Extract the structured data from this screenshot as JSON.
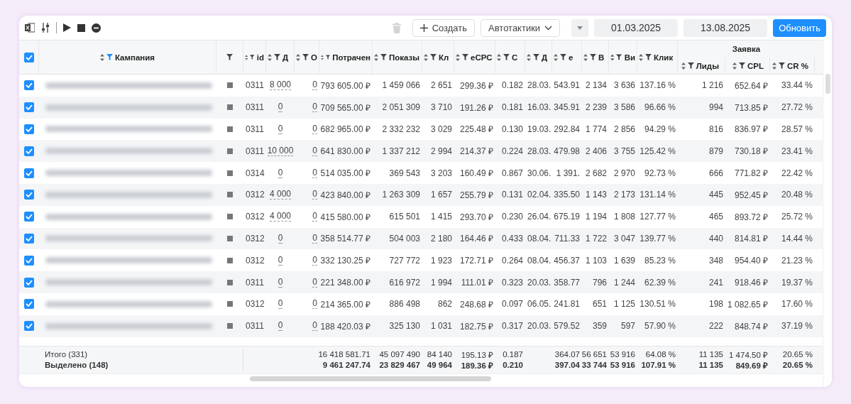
{
  "toolbar": {
    "delete_button": {
      "disabled": true
    },
    "create_button": {
      "label": "Создать"
    },
    "autotactics_button": {
      "label": "Автотактики"
    },
    "date_from": "01.03.2025",
    "date_to": "13.08.2025",
    "refresh_button": {
      "label": "Обновить"
    }
  },
  "table": {
    "header_checked": true,
    "name_column": {
      "label": "Кампания",
      "filter_active": true
    },
    "status_column": {
      "filter_active": false
    },
    "columns": [
      {
        "label": "id",
        "kind": "id",
        "filter_active": false
      },
      {
        "label": "Д",
        "kind": "editable",
        "filter_active": false
      },
      {
        "label": "О",
        "kind": "editable",
        "filter_active": false
      },
      {
        "label": "Потрачен",
        "kind": "number",
        "filter_active": false
      },
      {
        "label": "Показы",
        "kind": "number",
        "filter_active": false
      },
      {
        "label": "Кл",
        "kind": "number",
        "filter_active": false
      },
      {
        "label": "eCPC",
        "kind": "number",
        "filter_active": false
      },
      {
        "label": "С",
        "kind": "number",
        "filter_active": false
      },
      {
        "label": "Д",
        "kind": "date",
        "filter_active": false
      },
      {
        "label": "e",
        "kind": "number",
        "filter_active": false
      },
      {
        "label": "В",
        "kind": "number",
        "filter_active": false
      },
      {
        "label": "Ви",
        "kind": "number",
        "filter_active": false
      },
      {
        "label": "Клик",
        "kind": "number",
        "filter_active": false
      }
    ],
    "groups": [
      {
        "label": "Заявка",
        "columns": [
          {
            "label": "Лиды",
            "kind": "number",
            "filter_active": false
          },
          {
            "label": "CPL",
            "kind": "number",
            "filter_active": false
          },
          {
            "label": "CR %",
            "kind": "number",
            "filter_active": false
          }
        ]
      }
    ],
    "rows": [
      {
        "checked": true,
        "stopped": true,
        "cells": [
          "0311",
          "8 000",
          "0",
          "793 605.00 ₽",
          "1 459 066",
          "2 651",
          "299.36 ₽",
          "0.182",
          "28.03.",
          "543.91",
          "2 134",
          "3 636",
          "137.16 %",
          "1 216",
          "652.64 ₽",
          "33.44 %"
        ]
      },
      {
        "checked": true,
        "stopped": true,
        "cells": [
          "0311",
          "0",
          "0",
          "709 565.00 ₽",
          "2 051 309",
          "3 710",
          "191.26 ₽",
          "0.181",
          "16.03.",
          "345.91",
          "2 239",
          "3 586",
          "96.66 %",
          "994",
          "713.85 ₽",
          "27.72 %"
        ]
      },
      {
        "checked": true,
        "stopped": true,
        "cells": [
          "0311",
          "0",
          "0",
          "682 965.00 ₽",
          "2 332 232",
          "3 029",
          "225.48 ₽",
          "0.130",
          "19.03.",
          "292.84",
          "1 774",
          "2 856",
          "94.29 %",
          "816",
          "836.97 ₽",
          "28.57 %"
        ]
      },
      {
        "checked": true,
        "stopped": true,
        "cells": [
          "0311",
          "10 000",
          "0",
          "641 830.00 ₽",
          "1 337 212",
          "2 994",
          "214.37 ₽",
          "0.224",
          "28.03.",
          "479.98",
          "2 406",
          "3 755",
          "125.42 %",
          "879",
          "730.18 ₽",
          "23.41 %"
        ]
      },
      {
        "checked": true,
        "stopped": true,
        "cells": [
          "0314",
          "0",
          "0",
          "514 035.00 ₽",
          "369 543",
          "3 203",
          "160.49 ₽",
          "0.867",
          "30.06.",
          "1 391.",
          "2 682",
          "2 970",
          "92.73 %",
          "666",
          "771.82 ₽",
          "22.42 %"
        ]
      },
      {
        "checked": true,
        "stopped": true,
        "cells": [
          "0312",
          "4 000",
          "0",
          "423 840.00 ₽",
          "1 263 309",
          "1 657",
          "255.79 ₽",
          "0.131",
          "02.04.",
          "335.50",
          "1 143",
          "2 173",
          "131.14 %",
          "445",
          "952.45 ₽",
          "20.48 %"
        ]
      },
      {
        "checked": true,
        "stopped": true,
        "cells": [
          "0312",
          "4 000",
          "0",
          "415 580.00 ₽",
          "615 501",
          "1 415",
          "293.70 ₽",
          "0.230",
          "26.04.",
          "675.19",
          "1 194",
          "1 808",
          "127.77 %",
          "465",
          "893.72 ₽",
          "25.72 %"
        ]
      },
      {
        "checked": true,
        "stopped": true,
        "cells": [
          "0312",
          "0",
          "0",
          "358 514.77 ₽",
          "504 003",
          "2 180",
          "164.46 ₽",
          "0.433",
          "08.04.",
          "711.33",
          "1 722",
          "3 047",
          "139.77 %",
          "440",
          "814.81 ₽",
          "14.44 %"
        ]
      },
      {
        "checked": true,
        "stopped": true,
        "cells": [
          "0312",
          "0",
          "0",
          "332 130.25 ₽",
          "727 772",
          "1 923",
          "172.71 ₽",
          "0.264",
          "08.04.",
          "456.37",
          "1 103",
          "1 639",
          "85.23 %",
          "348",
          "954.40 ₽",
          "21.23 %"
        ]
      },
      {
        "checked": true,
        "stopped": true,
        "cells": [
          "0311",
          "0",
          "0",
          "221 348.00 ₽",
          "616 972",
          "1 994",
          "111.01 ₽",
          "0.323",
          "20.03.",
          "358.77",
          "796",
          "1 244",
          "62.39 %",
          "241",
          "918.46 ₽",
          "19.37 %"
        ]
      },
      {
        "checked": true,
        "stopped": true,
        "cells": [
          "0312",
          "0",
          "0",
          "214 365.00 ₽",
          "886 498",
          "862",
          "248.68 ₽",
          "0.097",
          "06.05.",
          "241.81",
          "651",
          "1 125",
          "130.51 %",
          "198",
          "1 082.65 ₽",
          "17.60 %"
        ]
      },
      {
        "checked": true,
        "stopped": true,
        "cells": [
          "0311",
          "0",
          "0",
          "188 420.03 ₽",
          "325 130",
          "1 031",
          "182.75 ₽",
          "0.317",
          "20.03.",
          "579.52",
          "359",
          "597",
          "57.90 %",
          "222",
          "848.74 ₽",
          "37.19 %"
        ]
      }
    ],
    "footer": [
      {
        "label": "Итого (331)",
        "kind": "total",
        "values": [
          "16 418 581.71",
          "45 097 490",
          "84 140",
          "195.13 ₽",
          "0.187",
          "364.07",
          "56 651",
          "53 916",
          "64.08 %",
          "11 135",
          "1 474.50 ₽",
          "20.65 %"
        ]
      },
      {
        "label": "Выделено (148)",
        "kind": "selected",
        "values": [
          "9 461 247.74",
          "23 829 467",
          "49 964",
          "189.36 ₽",
          "0.210",
          "397.04",
          "33 744",
          "53 916",
          "107.91 %",
          "11 135",
          "849.69 ₽",
          "20.65 %"
        ]
      }
    ]
  }
}
